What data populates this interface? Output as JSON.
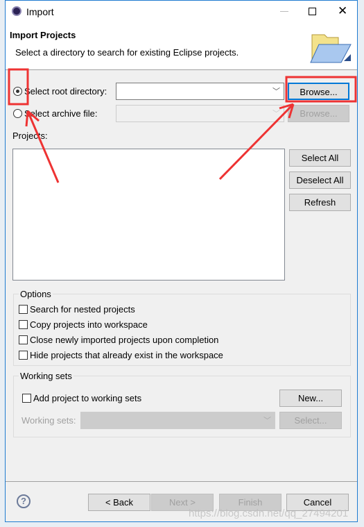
{
  "window": {
    "title": "Import"
  },
  "header": {
    "title": "Import Projects",
    "description": "Select a directory to search for existing Eclipse projects."
  },
  "source": {
    "root_label": "Select root directory:",
    "root_value": "",
    "archive_label": "Select archive file:",
    "archive_value": "",
    "browse_label": "Browse...",
    "browse_archive_label": "Browse...",
    "selected": "root"
  },
  "projects": {
    "label": "Projects:",
    "items": [],
    "select_all": "Select All",
    "deselect_all": "Deselect All",
    "refresh": "Refresh"
  },
  "options": {
    "title": "Options",
    "items": [
      {
        "label": "Search for nested projects",
        "checked": false
      },
      {
        "label": "Copy projects into workspace",
        "checked": false
      },
      {
        "label": "Close newly imported projects upon completion",
        "checked": false
      },
      {
        "label": "Hide projects that already exist in the workspace",
        "checked": false
      }
    ]
  },
  "working_sets": {
    "title": "Working sets",
    "add_label": "Add project to working sets",
    "new_label": "New...",
    "sets_label": "Working sets:",
    "select_label": "Select..."
  },
  "footer": {
    "back": "< Back",
    "next": "Next >",
    "finish": "Finish",
    "cancel": "Cancel"
  },
  "watermark": "https://blog.csdn.net/qq_27494201",
  "annotation_color": "#ee3333"
}
